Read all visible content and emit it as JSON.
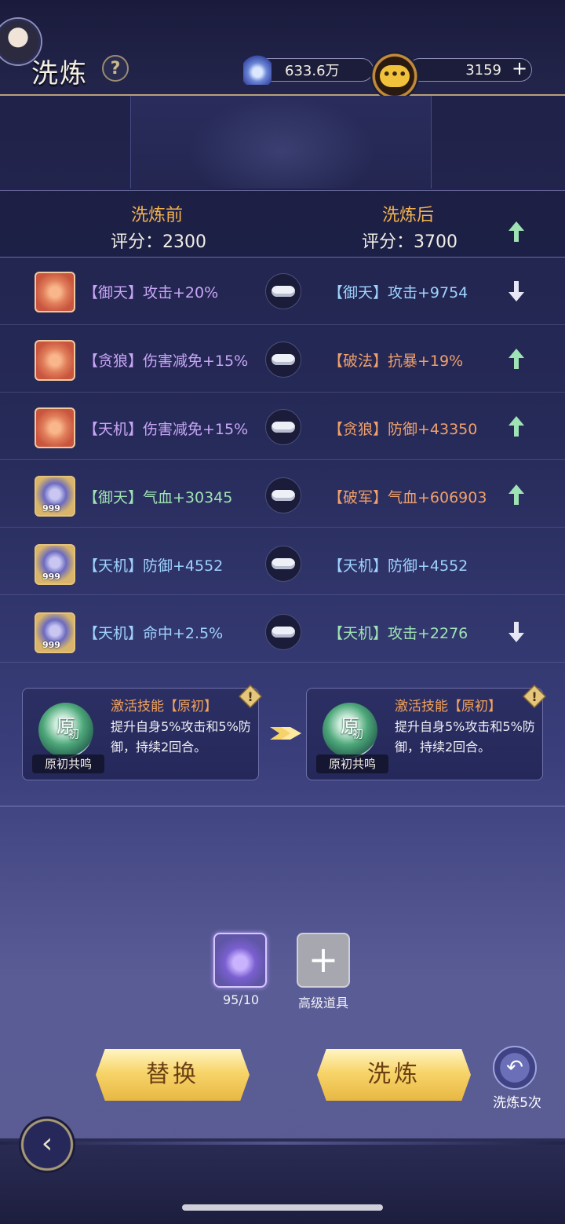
{
  "header": {
    "title": "洗炼",
    "help_icon": "question-icon",
    "currency_gems": "633.6万",
    "currency_gold": "3159",
    "plus_label": "+"
  },
  "compare": {
    "before_title": "洗炼前",
    "after_title": "洗炼后",
    "before_score": "评分：2300",
    "after_score": "评分：3700"
  },
  "rows": [
    {
      "left": "【御天】攻击+20%",
      "right": "【御天】攻击+9754",
      "trend": "down"
    },
    {
      "left": "【贪狼】伤害减免+15%",
      "right": "【破法】抗暴+19%",
      "trend": "up"
    },
    {
      "left": "【天机】伤害减免+15%",
      "right": "【贪狼】防御+43350",
      "trend": "up"
    },
    {
      "left": "【御天】气血+30345",
      "right": "【破军】气血+606903",
      "trend": "up"
    },
    {
      "left": "【天机】防御+4552",
      "right": "【天机】防御+4552",
      "trend": "none"
    },
    {
      "left": "【天机】命中+2.5%",
      "right": "【天机】攻击+2276",
      "trend": "down"
    }
  ],
  "badge_999": "999",
  "skills": {
    "before": {
      "title": "激活技能【原初】",
      "desc": "提升自身5%攻击和5%防御，持续2回合。",
      "orb_main": "原",
      "orb_sub": "初",
      "name": "原初共鸣"
    },
    "after": {
      "title": "激活技能【原初】",
      "desc": "提升自身5%攻击和5%防御，持续2回合。",
      "orb_main": "原",
      "orb_sub": "初",
      "name": "原初共鸣"
    }
  },
  "materials": {
    "crystal_count": "95/10",
    "advanced_item_label": "高级道具"
  },
  "buttons": {
    "replace": "替换",
    "refine": "洗炼",
    "refine_5": "洗炼5次"
  },
  "colors": {
    "accent_gold": "#f3b24e",
    "arrow_up": "#9fe3b4",
    "arrow_down": "#e6e6f4"
  }
}
